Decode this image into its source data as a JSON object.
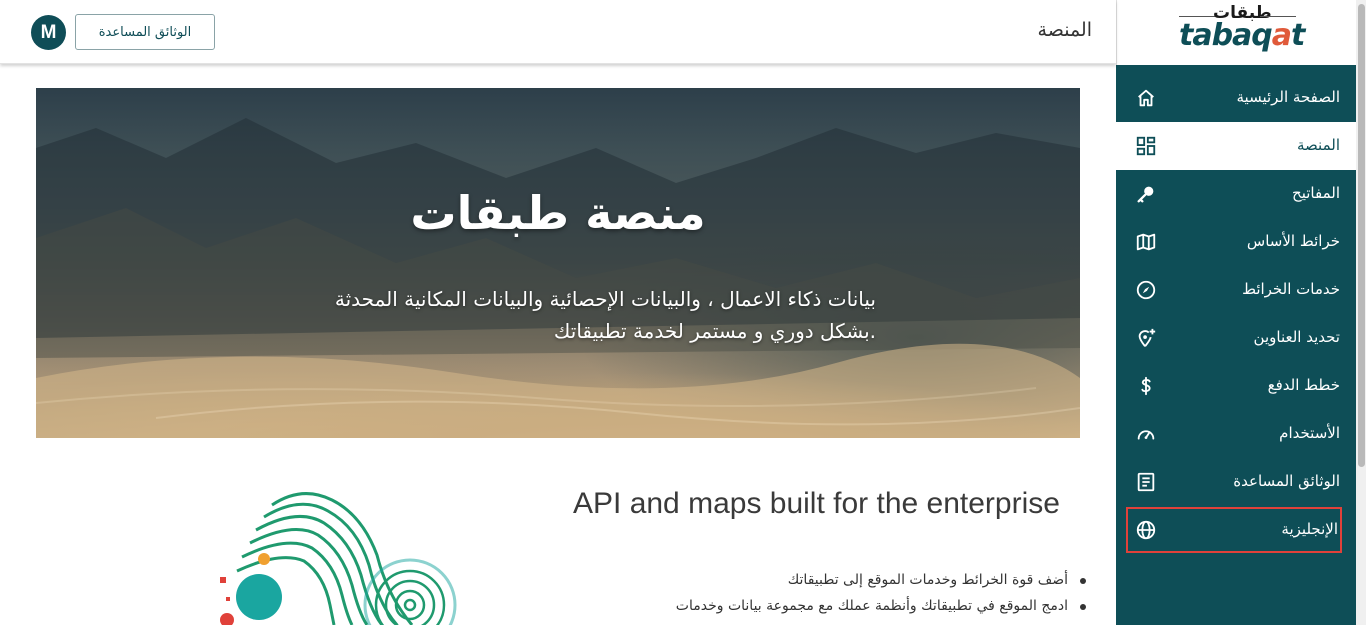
{
  "header": {
    "title": "المنصة",
    "docs_button": "الوثائق المساعدة",
    "avatar_letter": "M"
  },
  "logo": {
    "arabic": "طبقات",
    "latin_prefix": "tabaq",
    "latin_accent": "a",
    "latin_suffix": "t"
  },
  "sidebar": {
    "items": [
      {
        "label": "الصفحة الرئيسية",
        "icon": "home-icon"
      },
      {
        "label": "المنصة",
        "icon": "dashboard-grid-icon"
      },
      {
        "label": "المفاتيح",
        "icon": "key-icon"
      },
      {
        "label": "خرائط الأساس",
        "icon": "map-icon"
      },
      {
        "label": "خدمات الخرائط",
        "icon": "compass-icon"
      },
      {
        "label": "تحديد العناوين",
        "icon": "location-add-icon"
      },
      {
        "label": "خطط الدفع",
        "icon": "dollar-icon"
      },
      {
        "label": "الأستخدام",
        "icon": "speedometer-icon"
      },
      {
        "label": "الوثائق المساعدة",
        "icon": "document-icon"
      },
      {
        "label": "الإنجليزية",
        "icon": "globe-icon"
      }
    ],
    "active_index": 1,
    "highlighted_index": 9
  },
  "hero": {
    "title": "منصة طبقات",
    "subtitle_line1": "بيانات ذكاء الاعمال ، والبيانات الإحصائية والبيانات المكانية المحدثة",
    "subtitle_line2": "بشكل دوري و مستمر لخدمة تطبيقاتك."
  },
  "section": {
    "title": "API and maps built for the enterprise",
    "bullets": [
      "أضف قوة الخرائط وخدمات الموقع إلى تطبيقاتك",
      "ادمج الموقع في تطبيقاتك وأنظمة عملك مع مجموعة بيانات وخدمات"
    ]
  },
  "colors": {
    "sidebar_bg": "#0e4e57",
    "accent_red": "#e0413a",
    "art_green": "#1f9a6e",
    "art_teal": "#1aa6a0",
    "art_orange": "#f0a030"
  }
}
